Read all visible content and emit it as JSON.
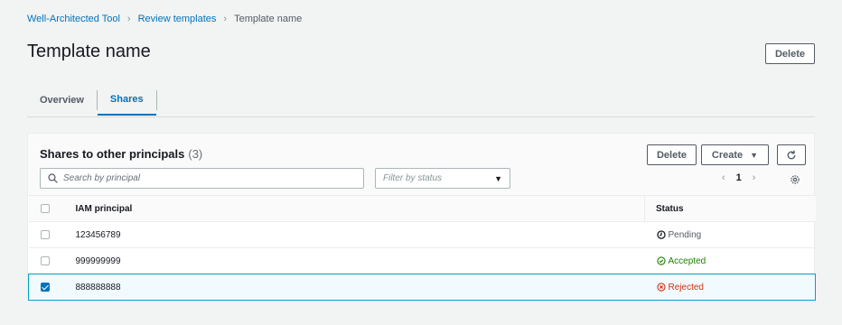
{
  "breadcrumb": {
    "items": [
      "Well-Architected Tool",
      "Review templates"
    ],
    "current": "Template name"
  },
  "header": {
    "title": "Template name",
    "delete_label": "Delete"
  },
  "tabs": [
    {
      "label": "Overview",
      "active": false
    },
    {
      "label": "Shares",
      "active": true
    }
  ],
  "panel": {
    "title": "Shares to other principals",
    "count": "(3)",
    "delete_label": "Delete",
    "create_label": "Create",
    "search_placeholder": "Search by principal",
    "filter_placeholder": "Filter by status",
    "page": "1",
    "columns": [
      "IAM principal",
      "Status"
    ],
    "rows": [
      {
        "principal": "123456789",
        "status": "Pending",
        "selected": false
      },
      {
        "principal": "999999999",
        "status": "Accepted",
        "selected": false
      },
      {
        "principal": "888888888",
        "status": "Rejected",
        "selected": true
      }
    ]
  },
  "colors": {
    "link": "#0073bb",
    "accepted": "#1d8102",
    "rejected": "#d13212",
    "pending": "#545b64"
  }
}
